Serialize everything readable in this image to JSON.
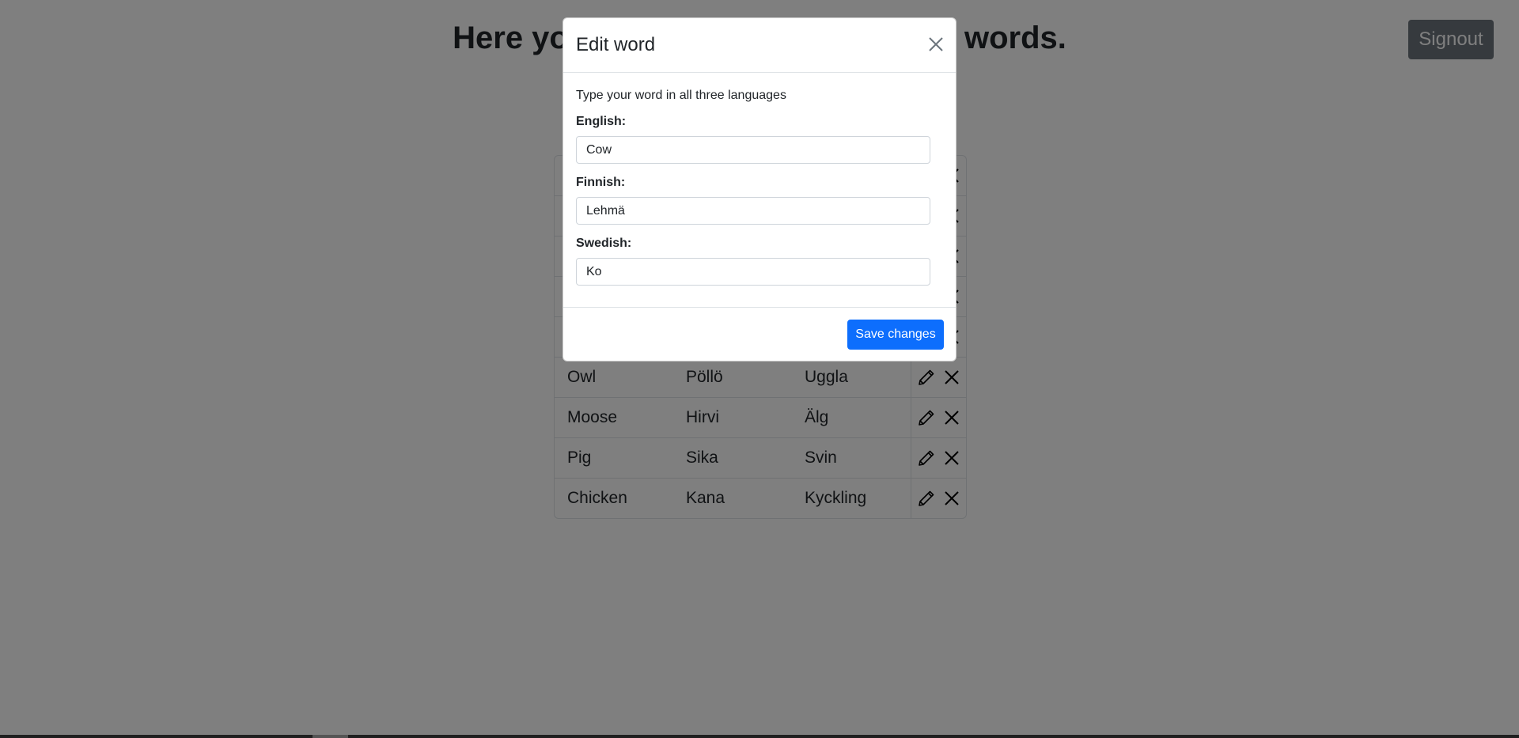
{
  "page": {
    "title": "Here you can add, edit and delete words.",
    "signout_label": "Signout"
  },
  "table": {
    "rows": [
      {
        "english": "",
        "finnish": "",
        "swedish": ""
      },
      {
        "english": "",
        "finnish": "",
        "swedish": ""
      },
      {
        "english": "",
        "finnish": "",
        "swedish": ""
      },
      {
        "english": "",
        "finnish": "",
        "swedish": ""
      },
      {
        "english": "",
        "finnish": "",
        "swedish": ""
      },
      {
        "english": "Owl",
        "finnish": "Pöllö",
        "swedish": "Uggla"
      },
      {
        "english": "Moose",
        "finnish": "Hirvi",
        "swedish": "Älg"
      },
      {
        "english": "Pig",
        "finnish": "Sika",
        "swedish": "Svin"
      },
      {
        "english": "Chicken",
        "finnish": "Kana",
        "swedish": "Kyckling"
      }
    ],
    "edit_icon": "pencil-icon",
    "delete_icon": "x-icon"
  },
  "modal": {
    "title": "Edit word",
    "hint": "Type your word in all three languages",
    "english_label": "English:",
    "english_value": "Cow",
    "finnish_label": "Finnish:",
    "finnish_value": "Lehmä",
    "swedish_label": "Swedish:",
    "swedish_value": "Ko",
    "save_label": "Save changes"
  },
  "colors": {
    "primary": "#0d6efd",
    "secondary": "#6c757d",
    "backdrop": "rgba(0,0,0,0.5)"
  }
}
